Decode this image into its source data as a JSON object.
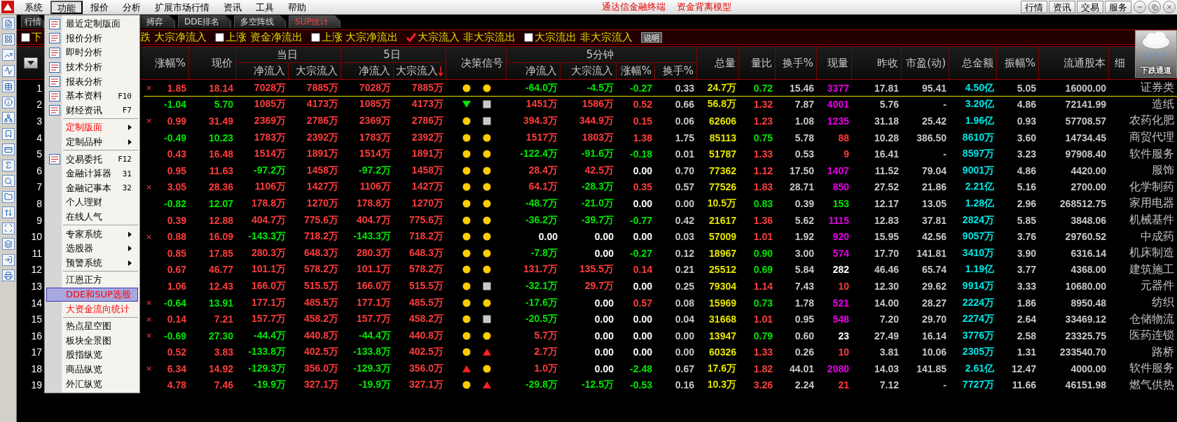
{
  "menubar": [
    {
      "label": "系统",
      "selected": false
    },
    {
      "label": "功能",
      "selected": true
    },
    {
      "label": "报价",
      "selected": false
    },
    {
      "label": "分析",
      "selected": false
    },
    {
      "label": "扩展市场行情",
      "selected": false
    },
    {
      "label": "资讯",
      "selected": false
    },
    {
      "label": "工具",
      "selected": false
    },
    {
      "label": "帮助",
      "selected": false
    }
  ],
  "title": [
    "通达信金融终端",
    "资金背离模型"
  ],
  "top_buttons": [
    "行情",
    "资讯",
    "交易",
    "服务"
  ],
  "tabs": [
    {
      "label": "行情",
      "selected": false
    },
    {
      "label": "搏弈",
      "selected": false
    },
    {
      "label": "DDE排名",
      "selected": false
    },
    {
      "label": "多空阵线",
      "selected": false
    },
    {
      "label": "SUP统计",
      "selected": true
    }
  ],
  "filters": [
    {
      "kind": "option",
      "label": "下",
      "checked": false
    },
    {
      "kind": "fragment",
      "label": "跌 大宗净流入"
    },
    {
      "kind": "option",
      "label": "上涨 资金净流出",
      "checked": false
    },
    {
      "kind": "option",
      "label": "上涨 大宗净流出",
      "checked": false
    },
    {
      "kind": "option",
      "label": "大宗流入 非大宗流出",
      "checked": true
    },
    {
      "kind": "option",
      "label": "大宗流出 非大宗流入",
      "checked": false
    },
    {
      "kind": "button",
      "label": "说明"
    }
  ],
  "weather": {
    "label": "下跌通道"
  },
  "columns": [
    {
      "label": "涨幅%"
    },
    {
      "label": "现价"
    },
    {
      "label": "当日",
      "children": [
        {
          "label": "净流入"
        },
        {
          "label": "大宗流入"
        }
      ]
    },
    {
      "label": "5日",
      "children": [
        {
          "label": "净流入",
          "sorted": false
        },
        {
          "label": "大宗流入",
          "sorted": true
        }
      ]
    },
    {
      "label": "决策信号"
    },
    {
      "label": "5分钟",
      "children": [
        {
          "label": "净流入"
        },
        {
          "label": "大宗流入"
        },
        {
          "label": "涨幅%"
        },
        {
          "label": "换手%"
        }
      ]
    },
    {
      "label": "总量"
    },
    {
      "label": "量比"
    },
    {
      "label": "换手%"
    },
    {
      "label": "现量"
    },
    {
      "label": "昨收"
    },
    {
      "label": "市盈(动)"
    },
    {
      "label": "总金额"
    },
    {
      "label": "振幅%"
    },
    {
      "label": "流通股本"
    },
    {
      "label": "细"
    }
  ],
  "rows": [
    {
      "no": "1",
      "selected": true,
      "mark": "×",
      "signals": [
        {
          "kind": "dot"
        },
        {
          "kind": "dot"
        }
      ],
      "cells": [
        {
          "text": "1.85",
          "color": "#ff3c3c"
        },
        {
          "text": "18.14",
          "color": "#ff3c3c"
        },
        {
          "text": "7028万",
          "color": "#ff3c3c"
        },
        {
          "text": "7885万",
          "color": "#ff3c3c"
        },
        {
          "text": "7028万",
          "color": "#ff3c3c"
        },
        {
          "text": "7885万",
          "color": "#ff3c3c"
        },
        {
          "text": "-64.0万",
          "color": "#00e600"
        },
        {
          "text": "-4.5万",
          "color": "#00e600"
        },
        {
          "text": "-0.27",
          "color": "#00e600"
        },
        "0.33",
        "24.7万",
        {
          "text": "0.72",
          "color": "#00e600"
        },
        "15.46",
        {
          "text": "3377",
          "color": "#e600e6"
        },
        "17.81",
        "95.41",
        "4.50亿",
        "5.05",
        "16000.00",
        "证券类"
      ]
    },
    {
      "no": "2",
      "selected": false,
      "signals": [
        {
          "kind": "down"
        },
        {
          "kind": "square"
        }
      ],
      "cells": [
        {
          "text": "-1.04",
          "color": "#00e600"
        },
        {
          "text": "5.70",
          "color": "#00e600"
        },
        {
          "text": "1085万",
          "color": "#ff3c3c"
        },
        {
          "text": "4173万",
          "color": "#ff3c3c"
        },
        {
          "text": "1085万",
          "color": "#ff3c3c"
        },
        {
          "text": "4173万",
          "color": "#ff3c3c"
        },
        {
          "text": "1451万",
          "color": "#ff3c3c"
        },
        {
          "text": "1586万",
          "color": "#ff3c3c"
        },
        {
          "text": "0.52",
          "color": "#ff3c3c"
        },
        "0.66",
        "56.8万",
        {
          "text": "1.32",
          "color": "#ff3c3c"
        },
        "7.87",
        {
          "text": "4001",
          "color": "#e600e6"
        },
        "5.76",
        "-",
        "3.20亿",
        "4.86",
        "72141.99",
        "造纸"
      ]
    },
    {
      "no": "3",
      "selected": false,
      "mark": "×",
      "signals": [
        {
          "kind": "dot"
        },
        {
          "kind": "square"
        }
      ],
      "cells": [
        {
          "text": "0.99",
          "color": "#ff3c3c"
        },
        {
          "text": "31.49",
          "color": "#ff3c3c"
        },
        {
          "text": "2369万",
          "color": "#ff3c3c"
        },
        {
          "text": "2786万",
          "color": "#ff3c3c"
        },
        {
          "text": "2369万",
          "color": "#ff3c3c"
        },
        {
          "text": "2786万",
          "color": "#ff3c3c"
        },
        {
          "text": "394.3万",
          "color": "#ff3c3c"
        },
        {
          "text": "344.9万",
          "color": "#ff3c3c"
        },
        {
          "text": "0.15",
          "color": "#ff3c3c"
        },
        "0.06",
        "62606",
        {
          "text": "1.23",
          "color": "#ff3c3c"
        },
        "1.08",
        {
          "text": "1235",
          "color": "#e600e6"
        },
        "31.18",
        "25.42",
        "1.96亿",
        "0.93",
        "57708.57",
        "农药化肥"
      ]
    },
    {
      "no": "4",
      "selected": false,
      "signals": [
        {
          "kind": "dot"
        },
        {
          "kind": "dot"
        }
      ],
      "cells": [
        {
          "text": "-0.49",
          "color": "#00e600"
        },
        {
          "text": "10.23",
          "color": "#00e600"
        },
        {
          "text": "1783万",
          "color": "#ff3c3c"
        },
        {
          "text": "2392万",
          "color": "#ff3c3c"
        },
        {
          "text": "1783万",
          "color": "#ff3c3c"
        },
        {
          "text": "2392万",
          "color": "#ff3c3c"
        },
        {
          "text": "1517万",
          "color": "#ff3c3c"
        },
        {
          "text": "1803万",
          "color": "#ff3c3c"
        },
        {
          "text": "1.38",
          "color": "#ff3c3c"
        },
        "1.75",
        "85113",
        {
          "text": "0.75",
          "color": "#00e600"
        },
        "5.78",
        {
          "text": "88",
          "color": "#ff3c3c"
        },
        "10.28",
        "386.50",
        "8610万",
        "3.60",
        "14734.45",
        "商贸代理"
      ]
    },
    {
      "no": "5",
      "selected": false,
      "signals": [
        {
          "kind": "dot"
        },
        {
          "kind": "dot"
        }
      ],
      "cells": [
        {
          "text": "0.43",
          "color": "#ff3c3c"
        },
        {
          "text": "16.48",
          "color": "#ff3c3c"
        },
        {
          "text": "1514万",
          "color": "#ff3c3c"
        },
        {
          "text": "1891万",
          "color": "#ff3c3c"
        },
        {
          "text": "1514万",
          "color": "#ff3c3c"
        },
        {
          "text": "1891万",
          "color": "#ff3c3c"
        },
        {
          "text": "-122.4万",
          "color": "#00e600"
        },
        {
          "text": "-91.6万",
          "color": "#00e600"
        },
        {
          "text": "-0.18",
          "color": "#00e600"
        },
        "0.01",
        "51787",
        {
          "text": "1.33",
          "color": "#ff3c3c"
        },
        "0.53",
        {
          "text": "9",
          "color": "#ff3c3c"
        },
        "16.41",
        "-",
        "8597万",
        "3.23",
        "97908.40",
        "软件服务"
      ]
    },
    {
      "no": "6",
      "selected": false,
      "signals": [
        {
          "kind": "dot"
        },
        {
          "kind": "dot"
        }
      ],
      "cells": [
        {
          "text": "0.95",
          "color": "#ff3c3c"
        },
        {
          "text": "11.63",
          "color": "#ff3c3c"
        },
        {
          "text": "-97.2万",
          "color": "#00e600"
        },
        {
          "text": "1458万",
          "color": "#ff3c3c"
        },
        {
          "text": "-97.2万",
          "color": "#00e600"
        },
        {
          "text": "1458万",
          "color": "#ff3c3c"
        },
        {
          "text": "28.4万",
          "color": "#ff3c3c"
        },
        {
          "text": "42.5万",
          "color": "#ff3c3c"
        },
        {
          "text": "0.00",
          "color": "#ffffff"
        },
        "0.70",
        "77362",
        {
          "text": "1.12",
          "color": "#ff3c3c"
        },
        "17.50",
        {
          "text": "1407",
          "color": "#e600e6"
        },
        "11.52",
        "79.04",
        "9001万",
        "4.86",
        "4420.00",
        "服饰"
      ]
    },
    {
      "no": "7",
      "selected": false,
      "mark": "×",
      "signals": [
        {
          "kind": "dot"
        },
        {
          "kind": "dot"
        }
      ],
      "cells": [
        {
          "text": "3.05",
          "color": "#ff3c3c"
        },
        {
          "text": "28.36",
          "color": "#ff3c3c"
        },
        {
          "text": "1106万",
          "color": "#ff3c3c"
        },
        {
          "text": "1427万",
          "color": "#ff3c3c"
        },
        {
          "text": "1106万",
          "color": "#ff3c3c"
        },
        {
          "text": "1427万",
          "color": "#ff3c3c"
        },
        {
          "text": "64.1万",
          "color": "#ff3c3c"
        },
        {
          "text": "-28.3万",
          "color": "#00e600"
        },
        {
          "text": "0.35",
          "color": "#ff3c3c"
        },
        "0.57",
        "77526",
        {
          "text": "1.83",
          "color": "#ff3c3c"
        },
        "28.71",
        {
          "text": "850",
          "color": "#e600e6"
        },
        "27.52",
        "21.86",
        "2.21亿",
        "5.16",
        "2700.00",
        "化学制药"
      ]
    },
    {
      "no": "8",
      "selected": false,
      "signals": [
        {
          "kind": "dot"
        },
        {
          "kind": "dot"
        }
      ],
      "cells": [
        {
          "text": "-0.82",
          "color": "#00e600"
        },
        {
          "text": "12.07",
          "color": "#00e600"
        },
        {
          "text": "178.8万",
          "color": "#ff3c3c"
        },
        {
          "text": "1270万",
          "color": "#ff3c3c"
        },
        {
          "text": "178.8万",
          "color": "#ff3c3c"
        },
        {
          "text": "1270万",
          "color": "#ff3c3c"
        },
        {
          "text": "-48.7万",
          "color": "#00e600"
        },
        {
          "text": "-21.0万",
          "color": "#00e600"
        },
        {
          "text": "0.00",
          "color": "#ffffff"
        },
        "0.00",
        "10.5万",
        {
          "text": "0.83",
          "color": "#00e600"
        },
        "0.39",
        {
          "text": "153",
          "color": "#00e600"
        },
        "12.17",
        "13.05",
        "1.28亿",
        "2.96",
        "268512.75",
        "家用电器"
      ]
    },
    {
      "no": "9",
      "selected": false,
      "signals": [
        {
          "kind": "dot"
        },
        {
          "kind": "dot"
        }
      ],
      "cells": [
        {
          "text": "0.39",
          "color": "#ff3c3c"
        },
        {
          "text": "12.88",
          "color": "#ff3c3c"
        },
        {
          "text": "404.7万",
          "color": "#ff3c3c"
        },
        {
          "text": "775.6万",
          "color": "#ff3c3c"
        },
        {
          "text": "404.7万",
          "color": "#ff3c3c"
        },
        {
          "text": "775.6万",
          "color": "#ff3c3c"
        },
        {
          "text": "-36.2万",
          "color": "#00e600"
        },
        {
          "text": "-39.7万",
          "color": "#00e600"
        },
        {
          "text": "-0.77",
          "color": "#00e600"
        },
        "0.42",
        "21617",
        {
          "text": "1.36",
          "color": "#ff3c3c"
        },
        "5.62",
        {
          "text": "1115",
          "color": "#e600e6"
        },
        "12.83",
        "37.81",
        "2824万",
        "5.85",
        "3848.06",
        "机械基件"
      ]
    },
    {
      "no": "10",
      "selected": false,
      "mark": "×",
      "signals": [
        {
          "kind": "dot"
        },
        {
          "kind": "dot"
        }
      ],
      "cells": [
        {
          "text": "0.88",
          "color": "#ff3c3c"
        },
        {
          "text": "16.09",
          "color": "#ff3c3c"
        },
        {
          "text": "-143.3万",
          "color": "#00e600"
        },
        {
          "text": "718.2万",
          "color": "#ff3c3c"
        },
        {
          "text": "-143.3万",
          "color": "#00e600"
        },
        {
          "text": "718.2万",
          "color": "#ff3c3c"
        },
        {
          "text": "0.00",
          "color": "#ffffff"
        },
        {
          "text": "0.00",
          "color": "#ffffff"
        },
        {
          "text": "0.00",
          "color": "#ffffff"
        },
        "0.03",
        "57009",
        {
          "text": "1.01",
          "color": "#ff3c3c"
        },
        "1.92",
        {
          "text": "920",
          "color": "#e600e6"
        },
        "15.95",
        "42.56",
        "9057万",
        "3.76",
        "29760.52",
        "中成药"
      ]
    },
    {
      "no": "11",
      "selected": false,
      "signals": [
        {
          "kind": "dot"
        },
        {
          "kind": "dot"
        }
      ],
      "cells": [
        {
          "text": "0.85",
          "color": "#ff3c3c"
        },
        {
          "text": "17.85",
          "color": "#ff3c3c"
        },
        {
          "text": "280.3万",
          "color": "#ff3c3c"
        },
        {
          "text": "648.3万",
          "color": "#ff3c3c"
        },
        {
          "text": "280.3万",
          "color": "#ff3c3c"
        },
        {
          "text": "648.3万",
          "color": "#ff3c3c"
        },
        {
          "text": "-7.8万",
          "color": "#00e600"
        },
        {
          "text": "0.00",
          "color": "#ffffff"
        },
        {
          "text": "-0.27",
          "color": "#00e600"
        },
        "0.12",
        "18967",
        {
          "text": "0.90",
          "color": "#00e600"
        },
        "3.00",
        {
          "text": "574",
          "color": "#e600e6"
        },
        "17.70",
        "141.81",
        "3410万",
        "3.90",
        "6316.14",
        "机床制造"
      ]
    },
    {
      "no": "12",
      "selected": false,
      "signals": [
        {
          "kind": "dot"
        },
        {
          "kind": "dot"
        }
      ],
      "cells": [
        {
          "text": "0.67",
          "color": "#ff3c3c"
        },
        {
          "text": "46.77",
          "color": "#ff3c3c"
        },
        {
          "text": "101.1万",
          "color": "#ff3c3c"
        },
        {
          "text": "578.2万",
          "color": "#ff3c3c"
        },
        {
          "text": "101.1万",
          "color": "#ff3c3c"
        },
        {
          "text": "578.2万",
          "color": "#ff3c3c"
        },
        {
          "text": "131.7万",
          "color": "#ff3c3c"
        },
        {
          "text": "135.5万",
          "color": "#ff3c3c"
        },
        {
          "text": "0.14",
          "color": "#ff3c3c"
        },
        "0.21",
        "25512",
        {
          "text": "0.69",
          "color": "#00e600"
        },
        "5.84",
        {
          "text": "282",
          "color": "#ffffff"
        },
        "46.46",
        "65.74",
        "1.19亿",
        "3.77",
        "4368.00",
        "建筑施工"
      ]
    },
    {
      "no": "13",
      "selected": false,
      "signals": [
        {
          "kind": "dot"
        },
        {
          "kind": "square"
        }
      ],
      "cells": [
        {
          "text": "1.06",
          "color": "#ff3c3c"
        },
        {
          "text": "12.43",
          "color": "#ff3c3c"
        },
        {
          "text": "166.0万",
          "color": "#ff3c3c"
        },
        {
          "text": "515.5万",
          "color": "#ff3c3c"
        },
        {
          "text": "166.0万",
          "color": "#ff3c3c"
        },
        {
          "text": "515.5万",
          "color": "#ff3c3c"
        },
        {
          "text": "-32.1万",
          "color": "#00e600"
        },
        {
          "text": "29.7万",
          "color": "#ff3c3c"
        },
        {
          "text": "0.00",
          "color": "#ffffff"
        },
        "0.25",
        "79304",
        {
          "text": "1.14",
          "color": "#ff3c3c"
        },
        "7.43",
        {
          "text": "10",
          "color": "#ff3c3c"
        },
        "12.30",
        "29.62",
        "9914万",
        "3.33",
        "10680.00",
        "元器件"
      ]
    },
    {
      "no": "14",
      "selected": false,
      "mark": "×",
      "signals": [
        {
          "kind": "dot"
        },
        {
          "kind": "dot"
        }
      ],
      "cells": [
        {
          "text": "-0.64",
          "color": "#00e600"
        },
        {
          "text": "13.91",
          "color": "#00e600"
        },
        {
          "text": "177.1万",
          "color": "#ff3c3c"
        },
        {
          "text": "485.5万",
          "color": "#ff3c3c"
        },
        {
          "text": "177.1万",
          "color": "#ff3c3c"
        },
        {
          "text": "485.5万",
          "color": "#ff3c3c"
        },
        {
          "text": "-17.6万",
          "color": "#00e600"
        },
        {
          "text": "0.00",
          "color": "#ffffff"
        },
        {
          "text": "0.57",
          "color": "#ff3c3c"
        },
        "0.08",
        "15969",
        {
          "text": "0.73",
          "color": "#00e600"
        },
        "1.78",
        {
          "text": "521",
          "color": "#e600e6"
        },
        "14.00",
        "28.27",
        "2224万",
        "1.86",
        "8950.48",
        "纺织"
      ]
    },
    {
      "no": "15",
      "selected": false,
      "mark": "×",
      "signals": [
        {
          "kind": "dot"
        },
        {
          "kind": "square"
        }
      ],
      "cells": [
        {
          "text": "0.14",
          "color": "#ff3c3c"
        },
        {
          "text": "7.21",
          "color": "#ff3c3c"
        },
        {
          "text": "157.7万",
          "color": "#ff3c3c"
        },
        {
          "text": "458.2万",
          "color": "#ff3c3c"
        },
        {
          "text": "157.7万",
          "color": "#ff3c3c"
        },
        {
          "text": "458.2万",
          "color": "#ff3c3c"
        },
        {
          "text": "-20.5万",
          "color": "#00e600"
        },
        {
          "text": "0.00",
          "color": "#ffffff"
        },
        {
          "text": "0.00",
          "color": "#ffffff"
        },
        "0.04",
        "31668",
        {
          "text": "1.01",
          "color": "#ff3c3c"
        },
        "0.95",
        {
          "text": "548",
          "color": "#e600e6"
        },
        "7.20",
        "29.70",
        "2274万",
        "2.64",
        "33469.12",
        "仓储物流"
      ]
    },
    {
      "no": "16",
      "selected": false,
      "mark": "×",
      "signals": [
        {
          "kind": "dot"
        },
        {
          "kind": "dot"
        }
      ],
      "cells": [
        {
          "text": "-0.69",
          "color": "#00e600"
        },
        {
          "text": "27.30",
          "color": "#00e600"
        },
        {
          "text": "-44.4万",
          "color": "#00e600"
        },
        {
          "text": "440.8万",
          "color": "#ff3c3c"
        },
        {
          "text": "-44.4万",
          "color": "#00e600"
        },
        {
          "text": "440.8万",
          "color": "#ff3c3c"
        },
        {
          "text": "5.7万",
          "color": "#ff3c3c"
        },
        {
          "text": "0.00",
          "color": "#ffffff"
        },
        {
          "text": "0.00",
          "color": "#ffffff"
        },
        "0.00",
        "13947",
        {
          "text": "0.79",
          "color": "#00e600"
        },
        "0.60",
        {
          "text": "23",
          "color": "#ffffff"
        },
        "27.49",
        "16.14",
        "3776万",
        "2.58",
        "23325.75",
        "医药连锁"
      ]
    },
    {
      "no": "17",
      "selected": false,
      "signals": [
        {
          "kind": "dot"
        },
        {
          "kind": "up"
        }
      ],
      "cells": [
        {
          "text": "0.52",
          "color": "#ff3c3c"
        },
        {
          "text": "3.83",
          "color": "#ff3c3c"
        },
        {
          "text": "-133.8万",
          "color": "#00e600"
        },
        {
          "text": "402.5万",
          "color": "#ff3c3c"
        },
        {
          "text": "-133.8万",
          "color": "#00e600"
        },
        {
          "text": "402.5万",
          "color": "#ff3c3c"
        },
        {
          "text": "2.7万",
          "color": "#ff3c3c"
        },
        {
          "text": "0.00",
          "color": "#ffffff"
        },
        {
          "text": "0.00",
          "color": "#ffffff"
        },
        "0.00",
        "60326",
        {
          "text": "1.33",
          "color": "#ff3c3c"
        },
        "0.26",
        {
          "text": "10",
          "color": "#ff3c3c"
        },
        "3.81",
        "10.06",
        "2305万",
        "1.31",
        "233540.70",
        "路桥"
      ]
    },
    {
      "no": "18",
      "selected": false,
      "mark": "×",
      "signals": [
        {
          "kind": "up"
        },
        {
          "kind": "dot"
        }
      ],
      "cells": [
        {
          "text": "6.34",
          "color": "#ff3c3c"
        },
        {
          "text": "14.92",
          "color": "#ff3c3c"
        },
        {
          "text": "-129.3万",
          "color": "#00e600"
        },
        {
          "text": "356.0万",
          "color": "#ff3c3c"
        },
        {
          "text": "-129.3万",
          "color": "#00e600"
        },
        {
          "text": "356.0万",
          "color": "#ff3c3c"
        },
        {
          "text": "1.0万",
          "color": "#ff3c3c"
        },
        {
          "text": "0.00",
          "color": "#ffffff"
        },
        {
          "text": "-2.48",
          "color": "#00e600"
        },
        "0.67",
        "17.6万",
        {
          "text": "1.82",
          "color": "#ff3c3c"
        },
        "44.01",
        {
          "text": "2080",
          "color": "#e600e6"
        },
        "14.03",
        "141.85",
        "2.61亿",
        "12.47",
        "4000.00",
        "软件服务"
      ]
    },
    {
      "no": "19",
      "selected": false,
      "signals": [
        {
          "kind": "dot"
        },
        {
          "kind": "up"
        }
      ],
      "cells": [
        {
          "text": "4.78",
          "color": "#ff3c3c"
        },
        {
          "text": "7.46",
          "color": "#ff3c3c"
        },
        {
          "text": "-19.9万",
          "color": "#00e600"
        },
        {
          "text": "327.1万",
          "color": "#ff3c3c"
        },
        {
          "text": "-19.9万",
          "color": "#00e600"
        },
        {
          "text": "327.1万",
          "color": "#ff3c3c"
        },
        {
          "text": "-29.8万",
          "color": "#00e600"
        },
        {
          "text": "-12.5万",
          "color": "#00e600"
        },
        {
          "text": "-0.53",
          "color": "#00e600"
        },
        "0.16",
        "10.3万",
        {
          "text": "3.26",
          "color": "#ff3c3c"
        },
        "2.24",
        {
          "text": "21",
          "color": "#ff3c3c"
        },
        "7.12",
        "-",
        "7727万",
        "11.66",
        "46151.98",
        "燃气供热"
      ]
    }
  ],
  "menu": {
    "items": [
      {
        "kind": "item",
        "label": "最近定制版面",
        "icon": true,
        "submenu": false,
        "selected": false,
        "emphasized": false
      },
      {
        "kind": "item",
        "label": "报价分析",
        "icon": true,
        "submenu": false,
        "selected": false,
        "emphasized": false
      },
      {
        "kind": "item",
        "label": "即时分析",
        "icon": true,
        "submenu": false,
        "selected": false,
        "emphasized": false
      },
      {
        "kind": "item",
        "label": "技术分析",
        "icon": true,
        "submenu": false,
        "selected": false,
        "emphasized": false
      },
      {
        "kind": "item",
        "label": "报表分析",
        "icon": true,
        "submenu": false,
        "selected": false,
        "emphasized": false
      },
      {
        "kind": "item",
        "label": "基本资料",
        "shortcut": "F10",
        "icon": true,
        "submenu": false,
        "selected": false,
        "emphasized": false
      },
      {
        "kind": "item",
        "label": "财经资讯",
        "shortcut": "F7",
        "icon": true,
        "submenu": false,
        "selected": false,
        "emphasized": false
      },
      {
        "kind": "separator"
      },
      {
        "kind": "item",
        "label": "定制版面",
        "icon": false,
        "submenu": true,
        "selected": false,
        "emphasized": true
      },
      {
        "kind": "item",
        "label": "定制品种",
        "icon": false,
        "submenu": true,
        "selected": false,
        "emphasized": false
      },
      {
        "kind": "separator"
      },
      {
        "kind": "item",
        "label": "交易委托",
        "shortcut": "F12",
        "icon": true,
        "submenu": false,
        "selected": false,
        "emphasized": false
      },
      {
        "kind": "item",
        "label": "金融计算器",
        "shortcut": "31",
        "icon": false,
        "submenu": false,
        "selected": false,
        "emphasized": false
      },
      {
        "kind": "item",
        "label": "金融记事本",
        "shortcut": "32",
        "icon": false,
        "submenu": false,
        "selected": false,
        "emphasized": false
      },
      {
        "kind": "item",
        "label": "个人理财",
        "icon": false,
        "submenu": false,
        "selected": false,
        "emphasized": false
      },
      {
        "kind": "item",
        "label": "在线人气",
        "icon": false,
        "submenu": false,
        "selected": false,
        "emphasized": false
      },
      {
        "kind": "separator"
      },
      {
        "kind": "item",
        "label": "专家系统",
        "icon": false,
        "submenu": true,
        "selected": false,
        "emphasized": false
      },
      {
        "kind": "item",
        "label": "选股器",
        "icon": false,
        "submenu": true,
        "selected": false,
        "emphasized": false
      },
      {
        "kind": "item",
        "label": "预警系统",
        "icon": false,
        "submenu": true,
        "selected": false,
        "emphasized": false
      },
      {
        "kind": "separator"
      },
      {
        "kind": "item",
        "label": "江恩正方",
        "icon": false,
        "submenu": false,
        "selected": false,
        "emphasized": false
      },
      {
        "kind": "item",
        "label": "DDE和SUP选股",
        "icon": false,
        "submenu": false,
        "selected": true,
        "emphasized": true
      },
      {
        "kind": "item",
        "label": "大资金流向统计",
        "icon": false,
        "submenu": false,
        "selected": false,
        "emphasized": true
      },
      {
        "kind": "separator"
      },
      {
        "kind": "item",
        "label": "热点星空图",
        "icon": false,
        "submenu": false,
        "selected": false,
        "emphasized": false
      },
      {
        "kind": "item",
        "label": "板块全景图",
        "icon": false,
        "submenu": false,
        "selected": false,
        "emphasized": false
      },
      {
        "kind": "item",
        "label": "股指纵览",
        "icon": false,
        "submenu": false,
        "selected": false,
        "emphasized": false
      },
      {
        "kind": "item",
        "label": "商品纵览",
        "icon": false,
        "submenu": false,
        "selected": false,
        "emphasized": false
      },
      {
        "kind": "item",
        "label": "外汇纵览",
        "icon": false,
        "submenu": false,
        "selected": false,
        "emphasized": false
      }
    ]
  }
}
